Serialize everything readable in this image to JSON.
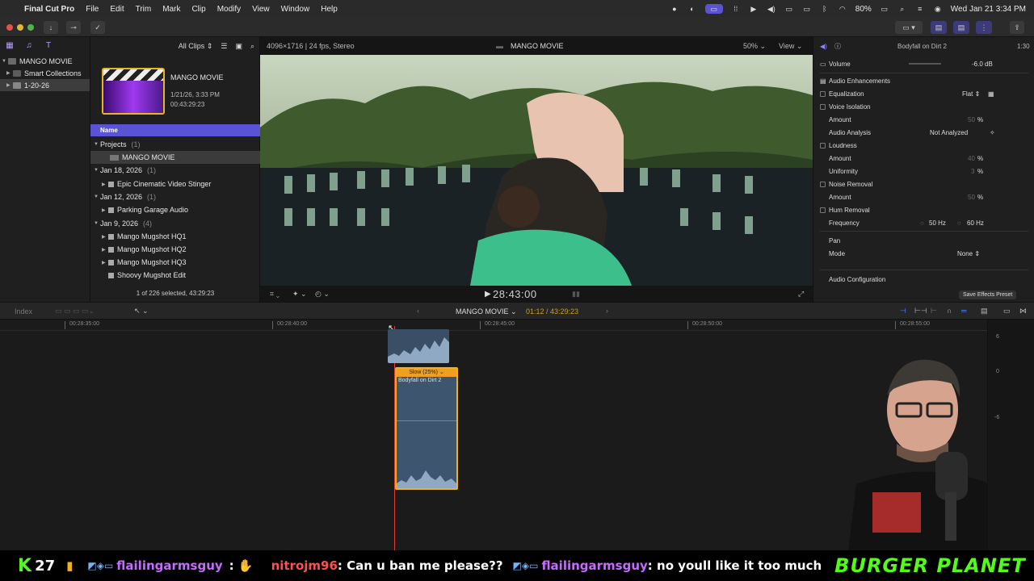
{
  "menubar": {
    "app": "Final Cut Pro",
    "menus": [
      "File",
      "Edit",
      "Trim",
      "Mark",
      "Clip",
      "Modify",
      "View",
      "Window",
      "Help"
    ],
    "battery": "80%",
    "datetime": "Wed Jan 21  3:34 PM"
  },
  "libraries": {
    "items": [
      {
        "label": "MANGO MOVIE"
      },
      {
        "label": "Smart Collections"
      },
      {
        "label": "1-20-26"
      }
    ]
  },
  "browser": {
    "filter": "All Clips",
    "project_card": {
      "title": "MANGO MOVIE",
      "date": "1/21/26, 3:33 PM",
      "duration": "00:43:29:23"
    },
    "column_name": "Name",
    "groups": [
      {
        "label": "Projects",
        "count": "(1)"
      },
      {
        "label": "MANGO MOVIE"
      },
      {
        "label": "Jan 18, 2026",
        "count": "(1)"
      },
      {
        "label": "Epic Cinematic Video Stinger"
      },
      {
        "label": "Jan 12, 2026",
        "count": "(1)"
      },
      {
        "label": "Parking Garage Audio"
      },
      {
        "label": "Jan 9, 2026",
        "count": "(4)"
      },
      {
        "label": "Mango Mugshot HQ1"
      },
      {
        "label": "Mango Mugshot HQ2"
      },
      {
        "label": "Mango Mugshot HQ3"
      },
      {
        "label": "Shoovy Mugshot Edit"
      }
    ],
    "status": "1 of 226 selected, 43:29:23"
  },
  "viewer": {
    "format": "4096×1716 | 24 fps, Stereo",
    "title": "MANGO MOVIE",
    "zoom": "50%",
    "view_label": "View",
    "timecode": "28:43:00"
  },
  "inspector": {
    "clip_name": "Bodyfall on Dirt 2",
    "clip_duration": "1:30",
    "volume_label": "Volume",
    "volume_value": "-6.0  dB",
    "audio_enhancements": "Audio Enhancements",
    "equalization": "Equalization",
    "eq_value": "Flat",
    "voice_isolation": "Voice Isolation",
    "vi_amount_label": "Amount",
    "vi_amount": "50",
    "audio_analysis": "Audio Analysis",
    "analysis_value": "Not Analyzed",
    "loudness": "Loudness",
    "ld_amount_label": "Amount",
    "ld_amount": "40",
    "uniformity": "Uniformity",
    "uniformity_value": "3",
    "noise_removal": "Noise Removal",
    "nr_amount_label": "Amount",
    "nr_amount": "50",
    "hum_removal": "Hum Removal",
    "frequency": "Frequency",
    "freq_50": "50 Hz",
    "freq_60": "60 Hz",
    "pan": "Pan",
    "mode": "Mode",
    "mode_value": "None",
    "audio_config": "Audio Configuration",
    "save_preset": "Save Effects Preset",
    "percent": "%"
  },
  "timeline": {
    "index": "Index",
    "project": "MANGO MOVIE",
    "position": "01:12 / 43:29:23",
    "ruler": [
      "00:28:35:00",
      "00:28:40:00",
      "00:28:45:00",
      "00:28:50:00",
      "00:28:55:00"
    ],
    "clip_retime": "Slow (25%)",
    "clip_name": "Bodyfall on Dirt 2",
    "meter_labels": [
      "6",
      "0",
      "-6"
    ]
  },
  "ticker": {
    "k_count": "27",
    "user1": "flailingarmsguy",
    "user2": "nitrojm96",
    "msg2": ": Can u ban me please??",
    "user3": "flailingarmsguy",
    "msg3": ": no youll like it too much",
    "brand": "BURGER PLANET"
  },
  "colors": {
    "accent": "#5b53d6",
    "clip_orange": "#f0a020",
    "playhead": "#e0402a"
  }
}
